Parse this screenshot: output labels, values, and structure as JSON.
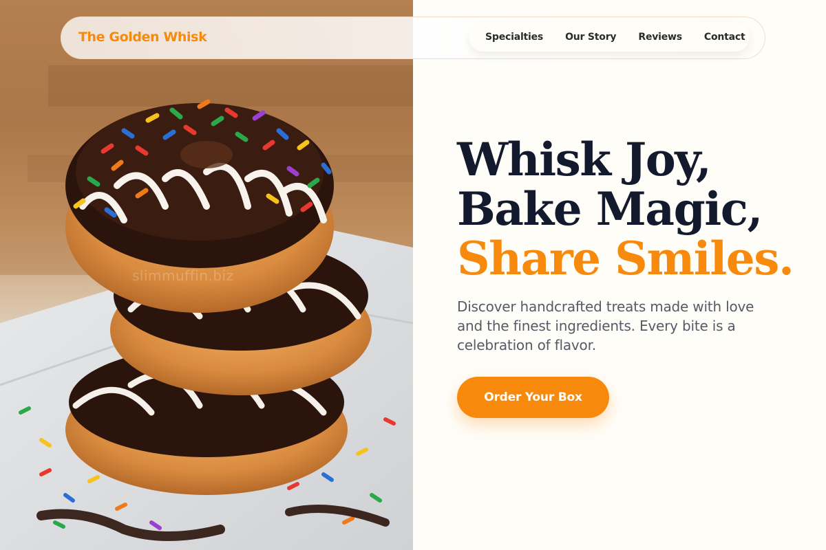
{
  "brand": {
    "name": "The Golden Whisk"
  },
  "nav": {
    "items": [
      {
        "label": "Specialties"
      },
      {
        "label": "Our Story"
      },
      {
        "label": "Reviews"
      },
      {
        "label": "Contact"
      }
    ]
  },
  "hero": {
    "title_line1": "Whisk Joy,",
    "title_line2": "Bake Magic,",
    "title_line3": "Share Smiles.",
    "subtitle": "Discover handcrafted treats made with love and the finest ingredients. Every bite is a celebration of flavor.",
    "cta_label": "Order Your Box"
  },
  "photo": {
    "watermark": "slimmuffin.biz"
  },
  "colors": {
    "accent": "#f78a0c",
    "heading": "#131a2e",
    "body_text": "#555a66",
    "page_bg": "#fffdf8"
  }
}
